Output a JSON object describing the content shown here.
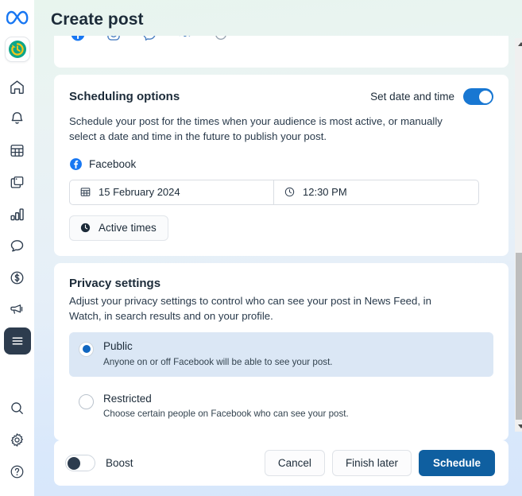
{
  "header": {
    "title": "Create post"
  },
  "sidebar": {
    "items": [
      {
        "icon": "meta-logo-icon",
        "name": "meta-logo"
      },
      {
        "icon": "scheduler-clock-icon",
        "name": "scheduler-app-tile"
      },
      {
        "icon": "home-icon",
        "name": "sidebar-item-home"
      },
      {
        "icon": "bell-icon",
        "name": "sidebar-item-notifications"
      },
      {
        "icon": "calendar-grid-icon",
        "name": "sidebar-item-planner"
      },
      {
        "icon": "pages-icon",
        "name": "sidebar-item-content"
      },
      {
        "icon": "bar-chart-icon",
        "name": "sidebar-item-insights"
      },
      {
        "icon": "chat-bubble-icon",
        "name": "sidebar-item-inbox"
      },
      {
        "icon": "dollar-circle-icon",
        "name": "sidebar-item-monetization"
      },
      {
        "icon": "megaphone-icon",
        "name": "sidebar-item-ads"
      },
      {
        "icon": "hamburger-menu-icon",
        "name": "sidebar-item-menu",
        "selected": true
      },
      {
        "icon": "search-icon",
        "name": "sidebar-item-search"
      },
      {
        "icon": "gear-icon",
        "name": "sidebar-item-settings"
      },
      {
        "icon": "help-circle-icon",
        "name": "sidebar-item-help"
      }
    ]
  },
  "platform_strip": {
    "icons": [
      "facebook-icon",
      "instagram-icon",
      "messenger-icon",
      "threads-icon",
      "whatsapp-icon"
    ]
  },
  "scheduling": {
    "title": "Scheduling options",
    "toggle_label": "Set date and time",
    "toggle_on": true,
    "description": "Schedule your post for the times when your audience is most active, or manually select a date and time in the future to publish your post.",
    "platform": "Facebook",
    "date_value": "15 February 2024",
    "time_value": "12:30 PM",
    "active_times_label": "Active times"
  },
  "privacy": {
    "title": "Privacy settings",
    "description": "Adjust your privacy settings to control who can see your post in News Feed, in Watch, in search results and on your profile.",
    "options": [
      {
        "label": "Public",
        "sub": "Anyone on or off Facebook will be able to see your post.",
        "selected": true
      },
      {
        "label": "Restricted",
        "sub": "Choose certain people on Facebook who can see your post.",
        "selected": false
      }
    ]
  },
  "footer": {
    "boost_label": "Boost",
    "boost_on": false,
    "cancel_label": "Cancel",
    "finish_later_label": "Finish later",
    "schedule_label": "Schedule"
  },
  "colors": {
    "primary_blue": "#0f5fa0",
    "toggle_blue": "#1877d2",
    "radio_blue": "#1066c0",
    "selected_row": "#dbe7f5",
    "rail_selected": "#2d3c4e"
  }
}
